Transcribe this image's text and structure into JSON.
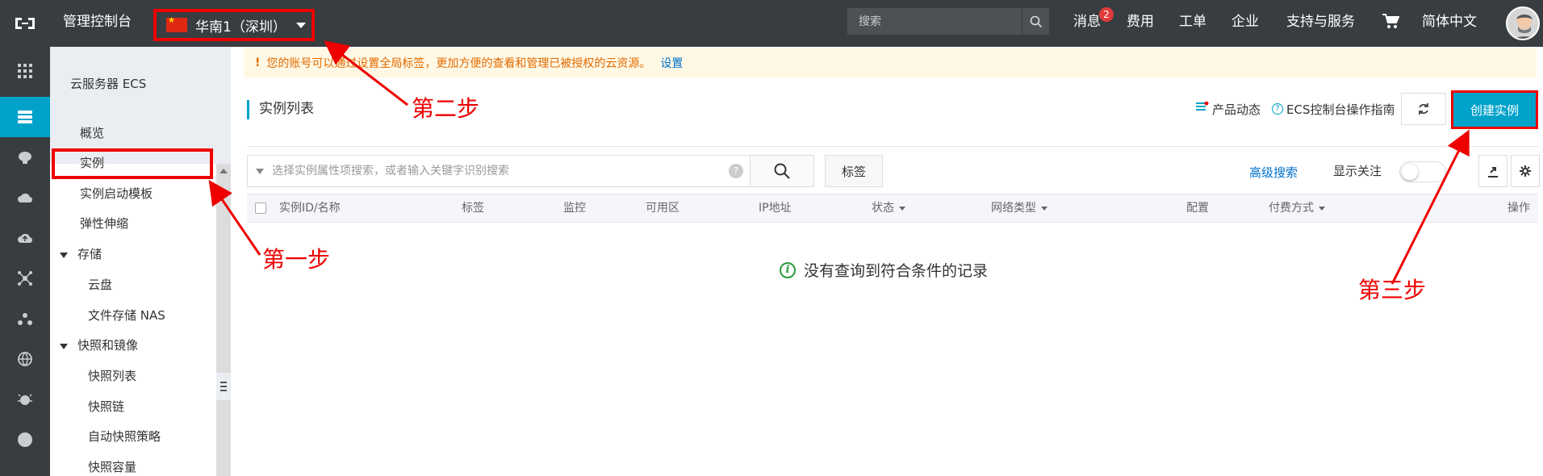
{
  "topbar": {
    "console_title": "管理控制台",
    "region": "华南1（深圳）",
    "search_placeholder": "搜索",
    "nav": {
      "messages": "消息",
      "messages_badge": "2",
      "billing": "费用",
      "tickets": "工单",
      "enterprise": "企业",
      "support": "支持与服务",
      "language": "简体中文"
    }
  },
  "sidebar": {
    "title": "云服务器 ECS",
    "items": [
      {
        "label": "概览"
      },
      {
        "label": "实例"
      },
      {
        "label": "实例启动模板"
      },
      {
        "label": "弹性伸缩"
      },
      {
        "label": "存储"
      },
      {
        "label": "云盘"
      },
      {
        "label": "文件存储 NAS"
      },
      {
        "label": "快照和镜像"
      },
      {
        "label": "快照列表"
      },
      {
        "label": "快照链"
      },
      {
        "label": "自动快照策略"
      },
      {
        "label": "快照容量"
      }
    ]
  },
  "notice": {
    "text": "您的账号可以通过设置全局标签，更加方便的查看和管理已被授权的云资源。",
    "link": "设置"
  },
  "page": {
    "title": "实例列表",
    "product_news": "产品动态",
    "guide": "ECS控制台操作指南",
    "create_button": "创建实例"
  },
  "filter": {
    "placeholder": "选择实例属性项搜索，或者输入关键字识别搜索",
    "tag_button": "标签",
    "advanced_search": "高级搜索",
    "show_follow": "显示关注"
  },
  "table": {
    "columns": [
      "实例ID/名称",
      "标签",
      "监控",
      "可用区",
      "IP地址",
      "状态",
      "网络类型",
      "配置",
      "付费方式",
      "操作"
    ],
    "empty_text": "没有查询到符合条件的记录"
  },
  "annotations": {
    "step1": "第一步",
    "step2": "第二步",
    "step3": "第三步"
  },
  "colors": {
    "topbar": "#373d41",
    "accent": "#00a2ca",
    "annotation": "#ee0000"
  }
}
